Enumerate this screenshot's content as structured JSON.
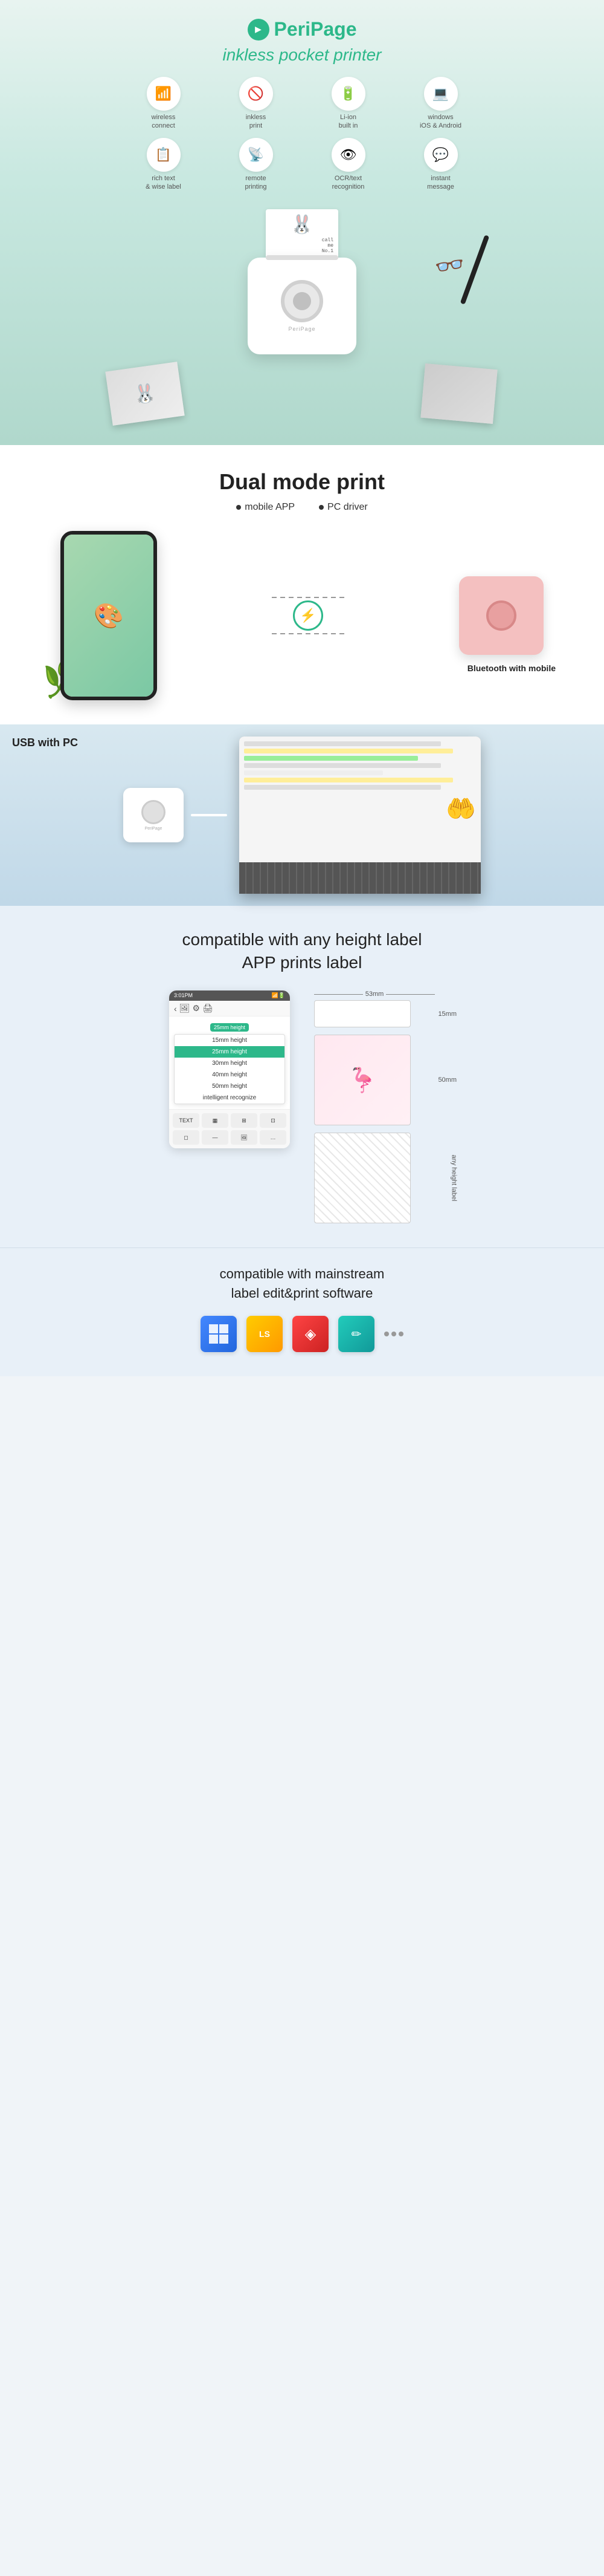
{
  "brand": {
    "name": "PeriPage",
    "tagline": "inkless pocket printer"
  },
  "features": [
    {
      "icon": "🔵",
      "label": "wireless\nconnect",
      "unicode": "⬡"
    },
    {
      "icon": "🚫",
      "label": "inkless\nprint",
      "unicode": "✕"
    },
    {
      "icon": "⚡",
      "label": "Li-ion\nbuilt in",
      "unicode": "⚡"
    },
    {
      "icon": "💻",
      "label": "windows\niOS & Android",
      "unicode": "⊞"
    },
    {
      "icon": "📝",
      "label": "rich text\n& wise label",
      "unicode": "T"
    },
    {
      "icon": "🖨",
      "label": "remote\nprinting",
      "unicode": "⊟"
    },
    {
      "icon": "👁",
      "label": "OCR/text\nrecognition",
      "unicode": "◎"
    },
    {
      "icon": "💬",
      "label": "instant\nmessage",
      "unicode": "✉"
    }
  ],
  "dual_mode": {
    "title": "Dual mode print",
    "bullets": [
      "mobile APP",
      "PC driver"
    ],
    "bluetooth_label": "Bluetooth with mobile",
    "usb_label": "USB with PC"
  },
  "label_section": {
    "title": "compatible with any height label",
    "subtitle": "APP prints label",
    "dimensions": {
      "width_mm": "53mm",
      "height_15": "15mm",
      "height_50": "50mm",
      "any_height": "any height label"
    },
    "app": {
      "time": "3:01PM",
      "height_badge": "25mm height",
      "dropdown_items": [
        "15mm height",
        "25mm height",
        "30mm height",
        "40mm height",
        "50mm height",
        "intelligent\nrecognize"
      ],
      "bottom_tools": [
        "TEXT",
        "□",
        "⚡",
        "≡",
        "↺",
        "—",
        "🔲",
        "◎",
        "↕"
      ]
    }
  },
  "software_section": {
    "title": "compatible with mainstream",
    "subtitle": "label edit&print software"
  },
  "printer": {
    "brand_text": "PeriPage"
  },
  "paper": {
    "lines": [
      "call",
      "me",
      "No.1"
    ]
  }
}
